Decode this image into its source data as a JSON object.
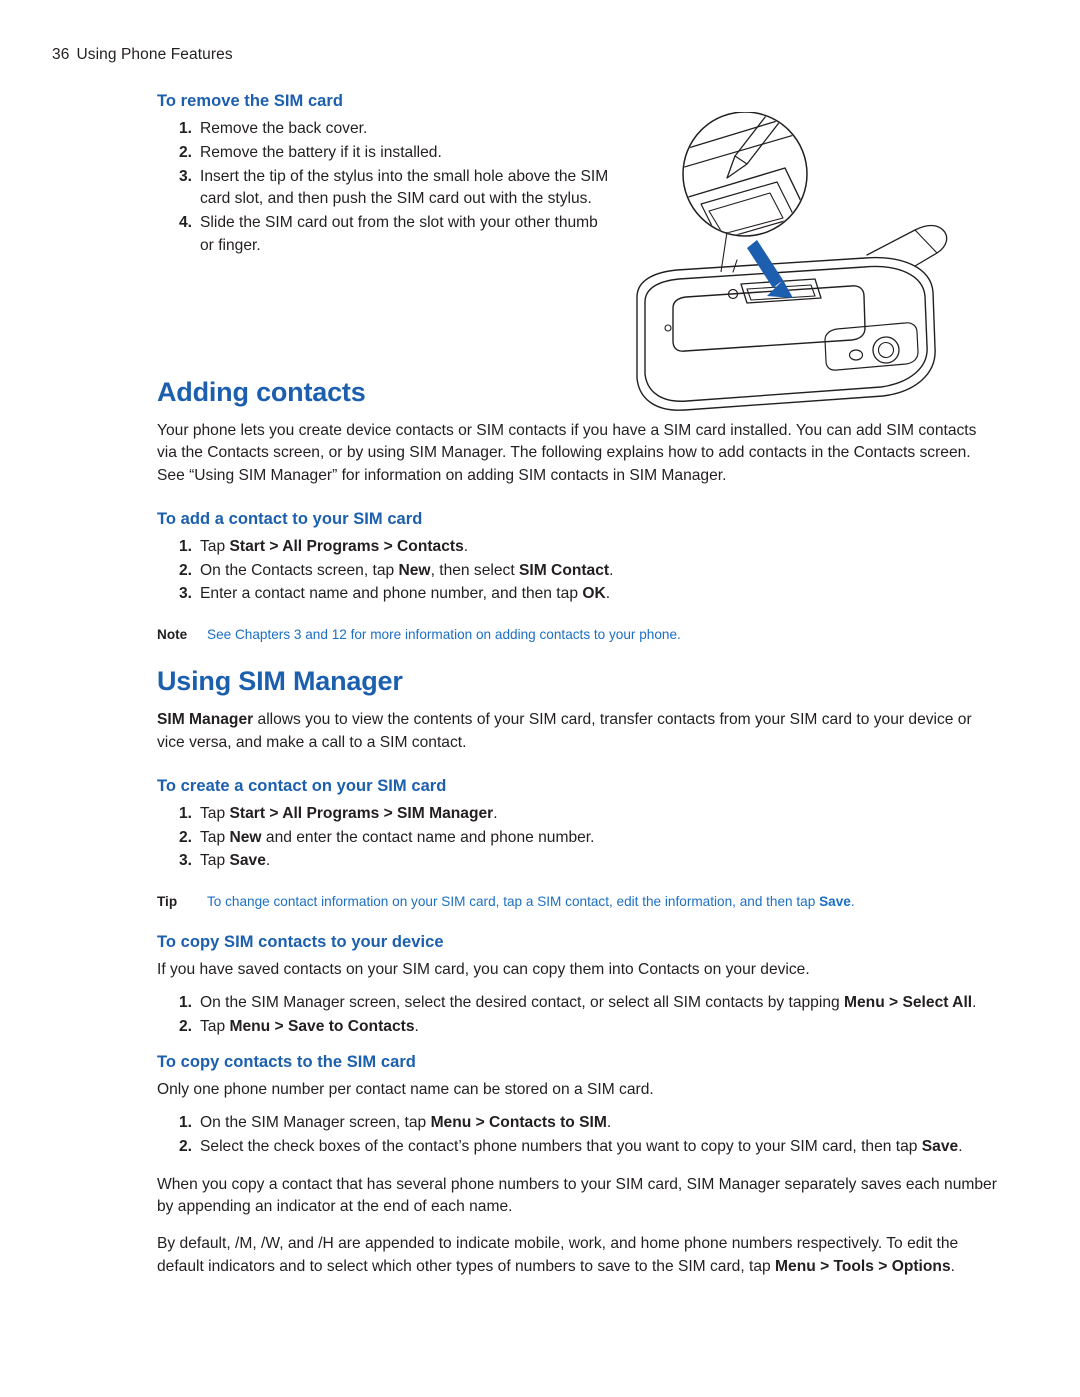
{
  "header": {
    "page_number": "36",
    "section": "Using Phone Features"
  },
  "sections": {
    "remove_sim": {
      "heading": "To remove the SIM card",
      "steps": [
        {
          "num": "1.",
          "text": "Remove the back cover."
        },
        {
          "num": "2.",
          "text": "Remove the battery if it is installed."
        },
        {
          "num": "3.",
          "text": "Insert the tip of the stylus into the small hole above the SIM card slot, and then push the SIM card out with the stylus."
        },
        {
          "num": "4.",
          "text": "Slide the SIM card out from the slot with your other thumb or finger."
        }
      ]
    },
    "adding_contacts": {
      "heading": "Adding contacts",
      "intro": "Your phone lets you create device contacts or SIM contacts if you have a SIM card installed. You can add SIM contacts via the Contacts screen, or by using SIM Manager. The following explains how to add contacts in the Contacts screen. See “Using SIM Manager” for information on adding SIM contacts in SIM Manager."
    },
    "add_contact_sim": {
      "heading": "To add a contact to your SIM card",
      "step1_pre": "Tap ",
      "step1_bold": "Start > All Programs > Contacts",
      "step1_post": ".",
      "step2_pre": "On the Contacts screen, tap ",
      "step2_bold1": "New",
      "step2_mid": ", then select ",
      "step2_bold2": "SIM Contact",
      "step2_post": ".",
      "step3_pre": "Enter a contact name and phone number, and then tap ",
      "step3_bold": "OK",
      "step3_post": "."
    },
    "note1": {
      "label": "Note",
      "text": "See Chapters 3 and 12 for more information on adding contacts to your phone."
    },
    "using_sim_manager": {
      "heading": "Using SIM Manager",
      "intro_bold": "SIM Manager",
      "intro_rest": " allows you to view the contents of your SIM card, transfer contacts from your SIM card to your device or vice versa, and make a call to a SIM contact."
    },
    "create_contact_sim": {
      "heading": "To create a contact on your SIM card",
      "step1_pre": "Tap ",
      "step1_bold": "Start > All Programs > SIM Manager",
      "step1_post": ".",
      "step2_pre": "Tap ",
      "step2_bold": "New",
      "step2_post": " and enter the contact name and phone number.",
      "step3_pre": "Tap ",
      "step3_bold": "Save",
      "step3_post": "."
    },
    "tip1": {
      "label": "Tip",
      "text_pre": "To change contact information on your SIM card, tap a SIM contact, edit the information, and then tap ",
      "text_bold": "Save",
      "text_post": "."
    },
    "copy_sim_to_device": {
      "heading": "To copy SIM contacts to your device",
      "intro": "If you have saved contacts on your SIM card, you can copy them into Contacts on your device.",
      "step1_pre": "On the SIM Manager screen, select the desired contact, or select all SIM contacts by tapping ",
      "step1_bold1": "Menu > Select All",
      "step1_post": ".",
      "step2_pre": "Tap ",
      "step2_bold": "Menu > Save to Contacts",
      "step2_post": "."
    },
    "copy_to_sim": {
      "heading": "To copy contacts to the SIM card",
      "intro": "Only one phone number per contact name can be stored on a SIM card.",
      "step1_pre": "On the SIM Manager screen, tap ",
      "step1_bold": "Menu > Contacts to SIM",
      "step1_post": ".",
      "step2_pre": "Select the check boxes of the contact’s phone numbers that you want to copy to your SIM card, then tap ",
      "step2_bold": "Save",
      "step2_post": ".",
      "para1": "When you copy a contact that has several phone numbers to your SIM card, SIM Manager separately saves each number by appending an indicator at the end of each name.",
      "para2_pre": "By default, /M, /W, and /H are appended to indicate mobile, work, and home phone numbers respectively. To edit the default indicators and to select which other types of numbers to save to the SIM card, tap ",
      "para2_bold1": "Menu > Tools > Options",
      "para2_post": "."
    }
  },
  "illustration": {
    "name": "phone-back-sim-slot-stylus-diagram",
    "accent_color": "#1b5fae"
  }
}
